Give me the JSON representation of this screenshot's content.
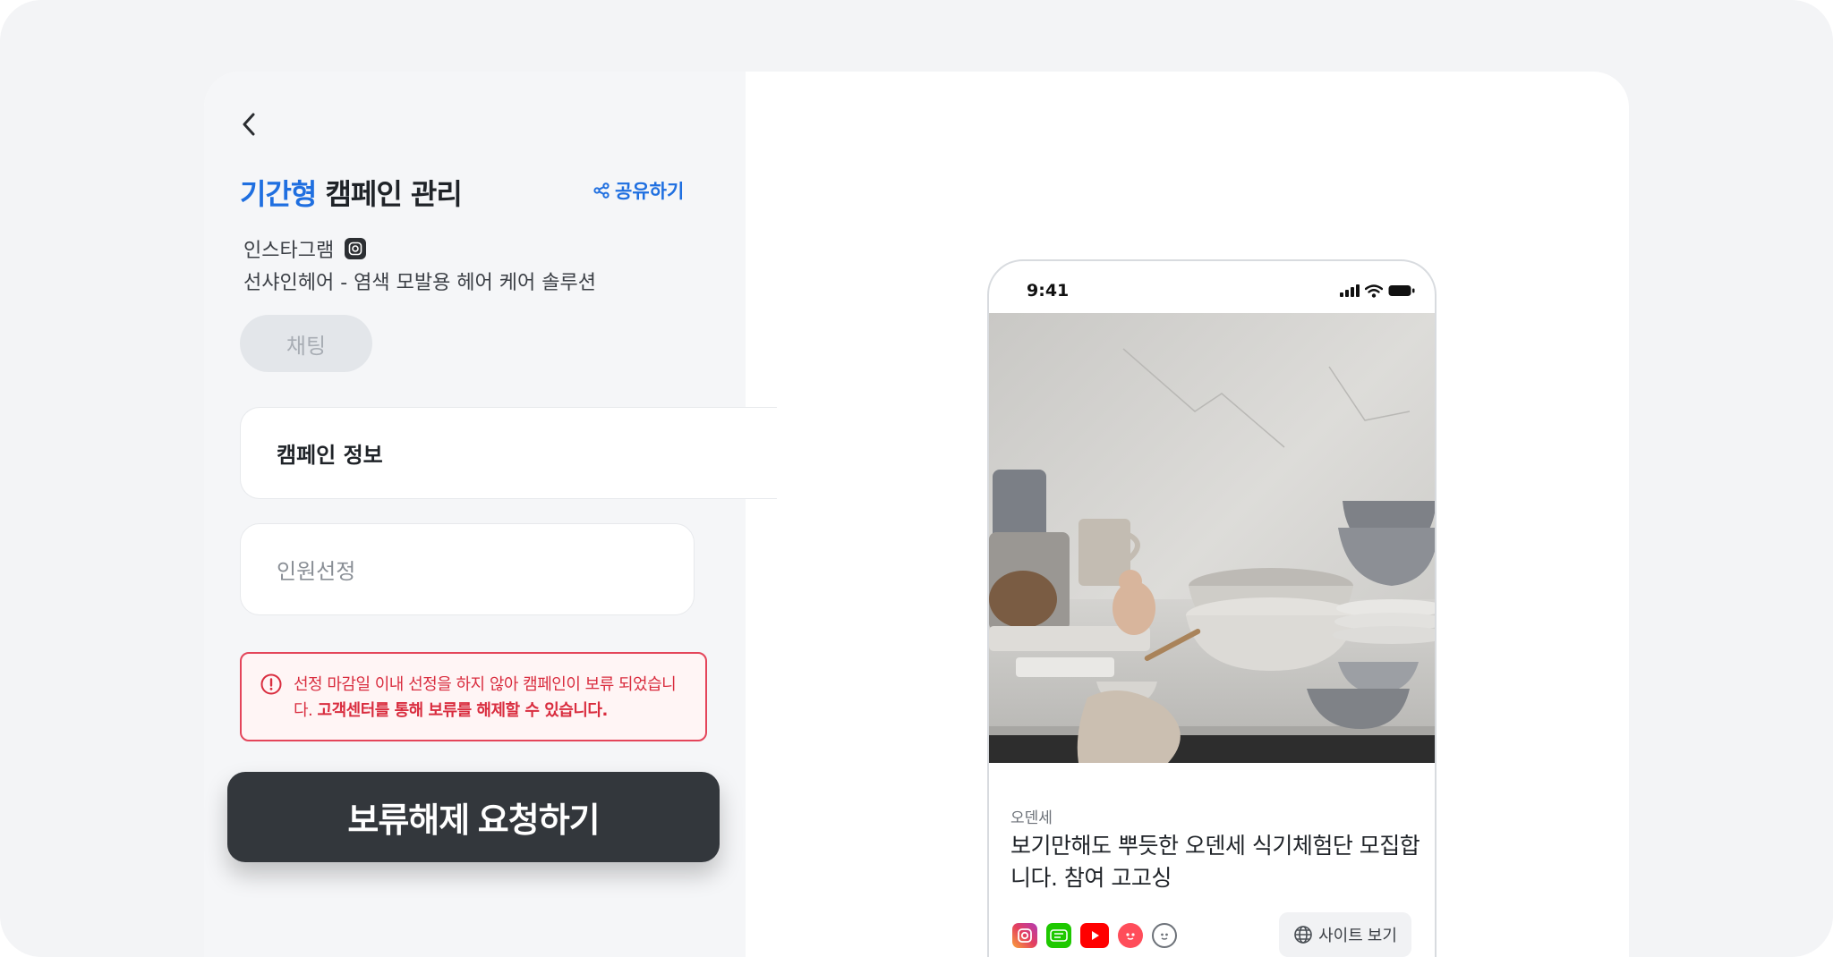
{
  "campaign": {
    "title_accent": "기간형",
    "title_rest": " 캠페인 관리",
    "share_label": "공유하기",
    "platform": "인스타그램",
    "name": "선샤인헤어 - 염색 모발용 헤어 케어 솔루션",
    "chat_label": "채팅"
  },
  "sections": {
    "info_label": "캠페인 정보",
    "selection_label": "인원선정"
  },
  "alert": {
    "text_main": "선정 마감일 이내 선정을 하지 않아 캠페인이 보류 되었습니다.",
    "text_bold": "고객센터를 통해 보류를 해제할 수 있습니다."
  },
  "cta": {
    "label": "보류해제 요청하기"
  },
  "preview": {
    "time": "9:41",
    "brand": "오덴세",
    "title": "보기만해도 뿌듯한 오덴세 식기체험단 모집합니다. 참여 고고싱",
    "site_label": "사이트 보기",
    "social_icons": [
      "instagram-icon",
      "blog-icon",
      "youtube-icon",
      "red-face-icon",
      "face-icon"
    ]
  },
  "colors": {
    "accent": "#1f6fe0",
    "danger": "#d92d3f",
    "cta": "#33373c"
  }
}
